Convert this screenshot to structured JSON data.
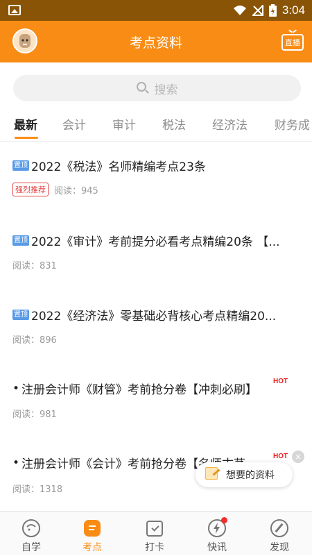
{
  "status_bar": {
    "time": "3:04"
  },
  "header": {
    "title": "考点资料",
    "live_label": "直播"
  },
  "search": {
    "placeholder": "搜索"
  },
  "tabs": [
    {
      "label": "最新",
      "active": true
    },
    {
      "label": "会计",
      "active": false
    },
    {
      "label": "审计",
      "active": false
    },
    {
      "label": "税法",
      "active": false
    },
    {
      "label": "经济法",
      "active": false
    },
    {
      "label": "财务成",
      "active": false
    }
  ],
  "articles": [
    {
      "pin": "置顶",
      "title": "2022《税法》名师精编考点23条",
      "recommend": "强烈推荐",
      "reads": "阅读：945"
    },
    {
      "pin": "置顶",
      "title": "2022《审计》考前提分必看考点精编20条 【...",
      "reads": "阅读：831"
    },
    {
      "pin": "置顶",
      "title": "2022《经济法》零基础必背核心考点精编20...",
      "reads": "阅读：896"
    },
    {
      "bullet": "•",
      "title": "注册会计师《财管》考前抢分卷【冲刺必刷】",
      "hot": "HOT",
      "reads": "阅读：981"
    },
    {
      "bullet": "•",
      "title": "注册会计师《会计》考前抢分卷【名师古茅",
      "hot": "HOT",
      "reads": "阅读：1318"
    }
  ],
  "float_button": {
    "label": "想要的资料",
    "close": "×"
  },
  "bottom_nav": [
    {
      "label": "自学",
      "icon": "self-study-icon",
      "active": false
    },
    {
      "label": "考点",
      "icon": "exam-points-icon",
      "active": true
    },
    {
      "label": "打卡",
      "icon": "check-in-icon",
      "active": false
    },
    {
      "label": "快讯",
      "icon": "news-flash-icon",
      "active": false,
      "dot": true
    },
    {
      "label": "发现",
      "icon": "discover-icon",
      "active": false
    }
  ],
  "colors": {
    "accent": "#f98c14",
    "status_bar": "#8a5407",
    "pin_badge": "#5a9be6",
    "hot": "#e81e1e"
  }
}
